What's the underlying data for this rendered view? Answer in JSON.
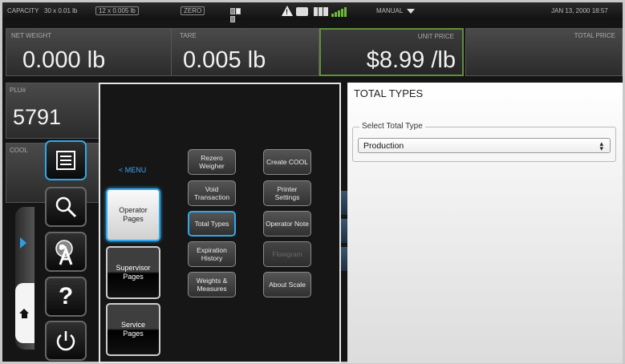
{
  "status": {
    "capacity": "CAPACITY",
    "capacity_value": "30 x 0.01 lb",
    "capacity_value2": "12 x 0.005 lb",
    "zero": "ZERO",
    "mode": "MANUAL",
    "datetime": "JAN 13, 2000 18:57"
  },
  "display": {
    "net_label": "NET WEIGHT",
    "net_value": "0.000 lb",
    "tare_label": "TARE",
    "tare_value": "0.005 lb",
    "unit_label": "UNIT PRICE",
    "unit_value": "$8.99 /lb",
    "total_label": "TOTAL PRICE",
    "plu_label": "PLU#",
    "plu_value": "5791",
    "cool_label": "COOL"
  },
  "menu": {
    "back_label": "< MENU",
    "categories": [
      {
        "label": "Operator Pages",
        "active": true
      },
      {
        "label": "Supervisor Pages",
        "active": false
      },
      {
        "label": "Service Pages",
        "active": false
      }
    ],
    "functions": [
      {
        "label": "Rezero Weigher"
      },
      {
        "label": "Create COOL"
      },
      {
        "label": "Void Transaction"
      },
      {
        "label": "Printer Settings"
      },
      {
        "label": "Total Types",
        "active": true
      },
      {
        "label": "Operator Note"
      },
      {
        "label": "Expiration History"
      },
      {
        "label": "Flowgram",
        "disabled": true
      },
      {
        "label": "Weights & Measures"
      },
      {
        "label": "About Scale"
      }
    ]
  },
  "total_types": {
    "title": "TOTAL TYPES",
    "legend": "Select Total Type",
    "selected": "Production"
  },
  "colors": {
    "accent": "#2fa8ec",
    "unit_price_border": "#5f8f3a",
    "signal": "#6db83a"
  },
  "icons": [
    "warning-icon",
    "printer-icon",
    "grid-icon",
    "signal-icon",
    "list-icon",
    "search-icon",
    "language-icon",
    "help-icon",
    "power-icon",
    "home-icon",
    "dock-arrow-icon"
  ]
}
